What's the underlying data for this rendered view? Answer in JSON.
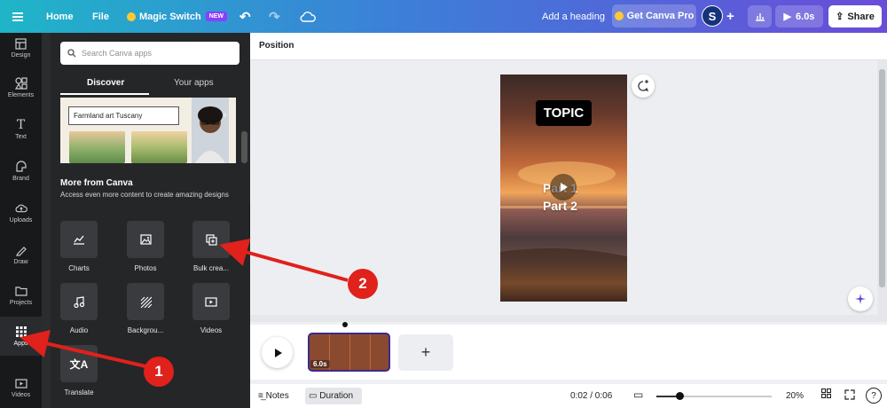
{
  "topbar": {
    "home": "Home",
    "file": "File",
    "magic_switch": "Magic Switch",
    "new_badge": "NEW",
    "add_heading": "Add a heading",
    "get_pro": "Get Canva Pro",
    "avatar_initial": "S",
    "play_duration": "6.0s",
    "share": "Share"
  },
  "rail": {
    "items": [
      {
        "label": "Design",
        "icon": "layout-icon"
      },
      {
        "label": "Elements",
        "icon": "shapes-icon"
      },
      {
        "label": "Text",
        "icon": "text-icon"
      },
      {
        "label": "Brand",
        "icon": "brand-icon"
      },
      {
        "label": "Uploads",
        "icon": "cloud-upload-icon"
      },
      {
        "label": "Draw",
        "icon": "pen-icon"
      },
      {
        "label": "Projects",
        "icon": "folder-icon"
      },
      {
        "label": "Apps",
        "icon": "grid-icon"
      },
      {
        "label": "Videos",
        "icon": "video-icon"
      }
    ]
  },
  "panel": {
    "search_placeholder": "Search Canva apps",
    "tabs": [
      "Discover",
      "Your apps"
    ],
    "banner_input": "Farmland art Tuscany",
    "more_title": "More from Canva",
    "more_desc": "Access even more content to create amazing designs",
    "apps": [
      {
        "label": "Charts"
      },
      {
        "label": "Photos"
      },
      {
        "label": "Bulk crea..."
      },
      {
        "label": "Audio"
      },
      {
        "label": "Backgrou..."
      },
      {
        "label": "Videos"
      },
      {
        "label": "Translate"
      }
    ]
  },
  "editor": {
    "toolbar_label": "Position",
    "design_topic": "TOPIC",
    "design_part1": "Part 1",
    "design_part2": "Part 2"
  },
  "timeline": {
    "clip_duration": "6.0s",
    "add_clip": "+"
  },
  "bottombar": {
    "notes": "Notes",
    "duration": "Duration",
    "time": "0:02 / 0:06",
    "zoom": "20%",
    "zoom_level": 0.2
  },
  "annotations": {
    "badge1": "1",
    "badge2": "2",
    "color": "#e0211c"
  }
}
